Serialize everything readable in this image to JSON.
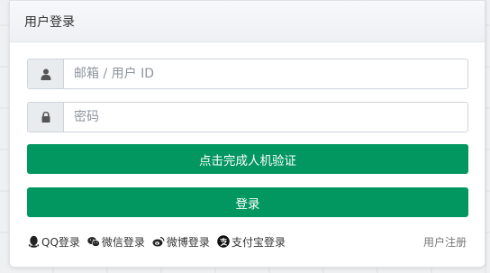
{
  "panel": {
    "title": "用户登录"
  },
  "form": {
    "username_placeholder": "邮箱 / 用户 ID",
    "username_value": "",
    "password_placeholder": "密码",
    "password_value": "",
    "captcha_button": "点击完成人机验证",
    "login_button": "登录"
  },
  "social": {
    "qq": "QQ登录",
    "wechat": "微信登录",
    "weibo": "微博登录",
    "alipay": "支付宝登录"
  },
  "register_link": "用户注册",
  "colors": {
    "primary": "#029760",
    "addon_bg": "#e9ecef"
  },
  "icons": [
    "user-icon",
    "lock-icon",
    "qq-icon",
    "wechat-icon",
    "weibo-icon",
    "alipay-icon"
  ]
}
